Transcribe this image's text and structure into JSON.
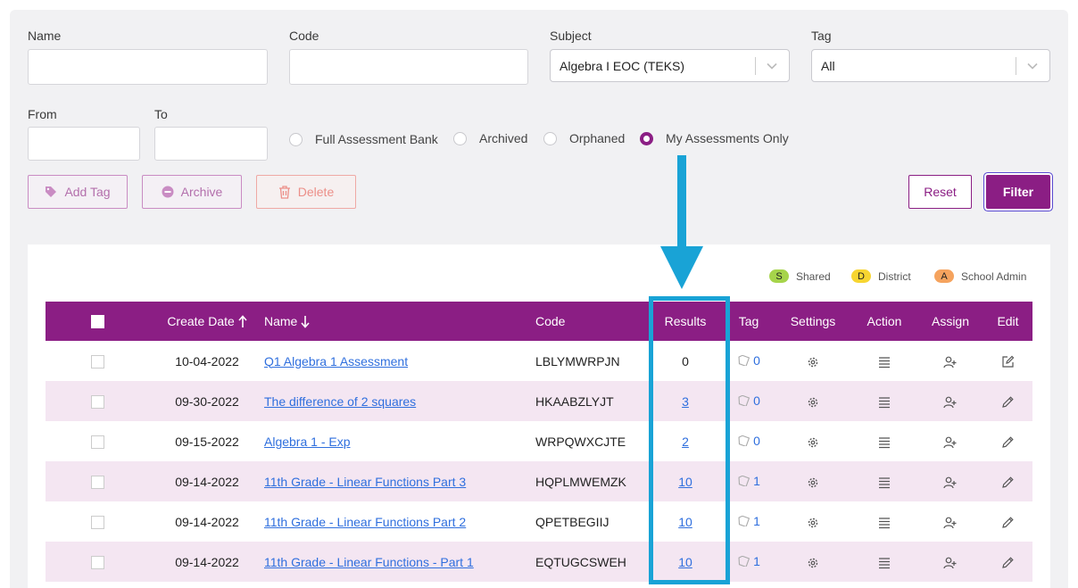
{
  "filters": {
    "name_label": "Name",
    "name_value": "",
    "code_label": "Code",
    "code_value": "",
    "subject_label": "Subject",
    "subject_value": "Algebra I EOC (TEKS)",
    "tag_label": "Tag",
    "tag_value": "All",
    "from_label": "From",
    "from_value": "",
    "to_label": "To",
    "to_value": "",
    "scope_options": [
      {
        "label": "Full Assessment Bank",
        "selected": false
      },
      {
        "label": "Archived",
        "selected": false
      },
      {
        "label": "Orphaned",
        "selected": false
      },
      {
        "label": "My Assessments Only",
        "selected": true
      }
    ]
  },
  "actions": {
    "add_tag": "Add Tag",
    "archive": "Archive",
    "delete": "Delete",
    "reset": "Reset",
    "filter": "Filter"
  },
  "legend": [
    {
      "badge": "S",
      "label": "Shared",
      "color": "#a6d44b"
    },
    {
      "badge": "D",
      "label": "District",
      "color": "#f7d531"
    },
    {
      "badge": "A",
      "label": "School Admin",
      "color": "#f5a35e"
    }
  ],
  "table": {
    "headers": {
      "create_date": "Create Date",
      "name": "Name",
      "code": "Code",
      "results": "Results",
      "tag": "Tag",
      "settings": "Settings",
      "action": "Action",
      "assign": "Assign",
      "edit": "Edit"
    },
    "rows": [
      {
        "date": "10-04-2022",
        "name": "Q1 Algebra 1 Assessment",
        "code": "LBLYMWRPJN",
        "results": "0",
        "results_link": false,
        "tag": "0",
        "edit_icon": "edit-square-icon"
      },
      {
        "date": "09-30-2022",
        "name": "The difference of 2 squares",
        "code": "HKAABZLYJT",
        "results": "3",
        "results_link": true,
        "tag": "0",
        "edit_icon": "pencil-icon"
      },
      {
        "date": "09-15-2022",
        "name": "Algebra 1 - Exp",
        "code": "WRPQWXCJTE",
        "results": "2",
        "results_link": true,
        "tag": "0",
        "edit_icon": "pencil-icon"
      },
      {
        "date": "09-14-2022",
        "name": "11th Grade - Linear Functions Part 3",
        "code": "HQPLMWEMZK",
        "results": "10",
        "results_link": true,
        "tag": "1",
        "edit_icon": "pencil-icon"
      },
      {
        "date": "09-14-2022",
        "name": "11th Grade - Linear Functions Part 2",
        "code": "QPETBEGIIJ",
        "results": "10",
        "results_link": true,
        "tag": "1",
        "edit_icon": "pencil-icon"
      },
      {
        "date": "09-14-2022",
        "name": "11th Grade - Linear Functions - Part 1",
        "code": "EQTUGCSWEH",
        "results": "10",
        "results_link": true,
        "tag": "1",
        "edit_icon": "pencil-icon"
      }
    ]
  },
  "annotation": {
    "color": "#19a3d6",
    "target": "results-column"
  },
  "colors": {
    "brand": "#8b1e84",
    "link": "#2f6fde",
    "row_alt": "#f4e6f2"
  }
}
